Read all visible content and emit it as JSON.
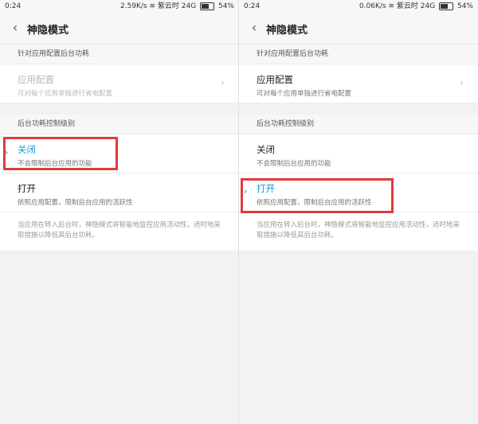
{
  "screens": [
    {
      "status": {
        "time": "0:24",
        "speed": "2.59K/s",
        "carrier": "紫云时",
        "network": "24G",
        "battery": "54%"
      },
      "title": "神隐模式",
      "section1_header": "针对应用配置后台功耗",
      "app_config": {
        "label": "应用配置",
        "sub": "可对每个应用单独进行省电配置"
      },
      "section2_header": "后台功耗控制级别",
      "off": {
        "label": "关闭",
        "sub": "不会限制后台应用的功能"
      },
      "on": {
        "label": "打开",
        "sub": "依照应用配置，限制后台应用的活跃性"
      },
      "note": "当应用在转入后台时，神隐模式将智能地监控应用活动性，适时地采取措施以降低其后台功耗。"
    },
    {
      "status": {
        "time": "0:24",
        "speed": "0.06K/s",
        "carrier": "紫云时",
        "network": "24G",
        "battery": "54%"
      },
      "title": "神隐模式",
      "section1_header": "针对应用配置后台功耗",
      "app_config": {
        "label": "应用配置",
        "sub": "可对每个应用单独进行省电配置"
      },
      "section2_header": "后台功耗控制级别",
      "off": {
        "label": "关闭",
        "sub": "不会限制后台应用的功能"
      },
      "on": {
        "label": "打开",
        "sub": "依照应用配置，限制后台应用的活跃性"
      },
      "note": "当应用在转入后台时，神隐模式将智能地监控应用活动性，适时地采取措施以降低其后台功耗。"
    }
  ],
  "icons": {
    "back": "chevron-left-icon",
    "chevron": "chevron-right-icon",
    "selected_marker": "selected-arrow-icon"
  },
  "colors": {
    "accent": "#1e9ad6",
    "highlight": "#e23a3a"
  }
}
